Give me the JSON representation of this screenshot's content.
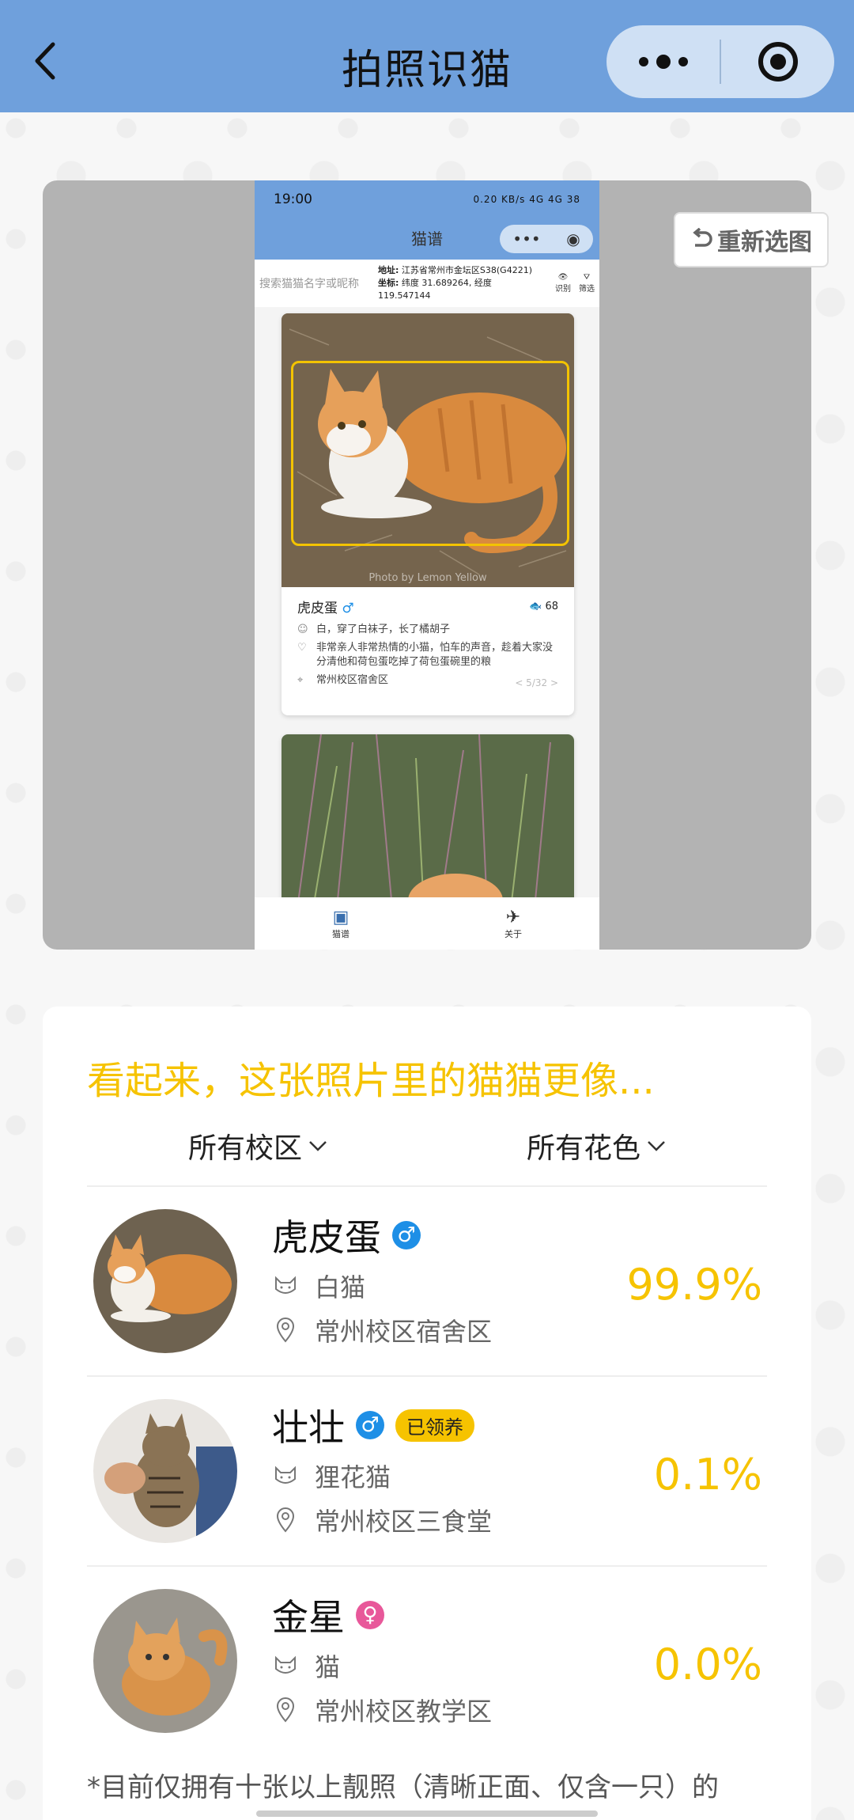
{
  "header": {
    "title": "拍照识猫",
    "back_icon": "chevron-left-icon",
    "more_icon": "more-dots-icon",
    "target_icon": "target-circle-icon",
    "bg_color": "#6fa0dc"
  },
  "preview": {
    "reselect_label": "重新选图",
    "screenshot": {
      "status_time": "19:00",
      "status_right": "0.20 KB/s 4G 4G 38",
      "nav_title": "猫谱",
      "search_placeholder": "搜索猫猫名字或昵称",
      "loc_address_label": "地址:",
      "loc_address": "江苏省常州市金坛区S38(G4221)",
      "loc_coord_label": "坐标:",
      "loc_coord_line1": "纬度 31.689264, 经度",
      "loc_coord_line2": "119.547144",
      "tool_identify": "识别",
      "tool_filter": "筛选",
      "card": {
        "photo_credit": "Photo by Lemon Yellow",
        "name": "虎皮蛋",
        "fish_count": "68",
        "desc": "白，穿了白袜子，长了橘胡子",
        "personality": "非常亲人非常热情的小猫，怕车的声音，趁着大家没分清他和荷包蛋吃掉了荷包蛋碗里的粮",
        "location": "常州校区宿舍区",
        "pager": "< 5/32 >"
      },
      "tab_catalog": "猫谱",
      "tab_about": "关于"
    }
  },
  "results": {
    "title": "看起来，这张照片里的猫猫更像...",
    "filter_campus": "所有校区",
    "filter_color": "所有花色",
    "cats": [
      {
        "name": "虎皮蛋",
        "gender": "male",
        "gender_symbol": "♂",
        "badge": "",
        "color": "白猫",
        "location": "常州校区宿舍区",
        "confidence": "99.9%"
      },
      {
        "name": "壮壮",
        "gender": "male",
        "gender_symbol": "♂",
        "badge": "已领养",
        "color": "狸花猫",
        "location": "常州校区三食堂",
        "confidence": "0.1%"
      },
      {
        "name": "金星",
        "gender": "female",
        "gender_symbol": "♀",
        "badge": "",
        "color": "猫",
        "location": "常州校区教学区",
        "confidence": "0.0%"
      }
    ],
    "note": "*目前仅拥有十张以上靓照（清晰正面、仅含一只）的"
  },
  "colors": {
    "accent_yellow": "#f6c300",
    "male_blue": "#1e8fe6",
    "female_pink": "#e8589a"
  }
}
